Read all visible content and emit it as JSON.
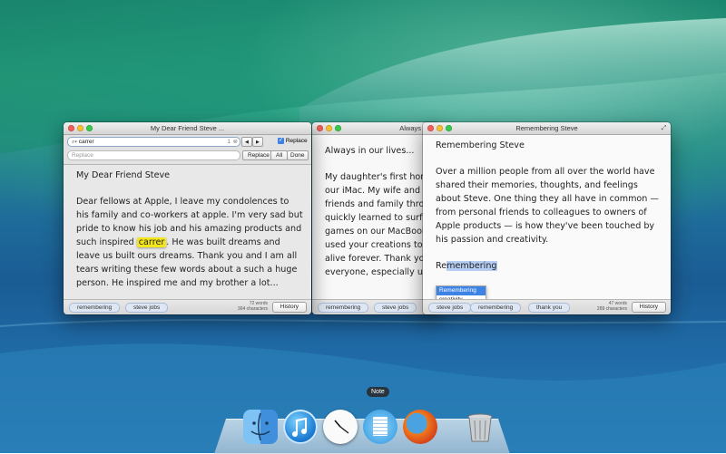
{
  "desktop": {
    "wallpaper": "ocean-wave"
  },
  "windows": {
    "win1": {
      "title": "My Dear Friend Steve ...",
      "find": {
        "query": "carrer",
        "count": "1",
        "replace_placeholder": "Replace",
        "replace_label": "Replace",
        "replace_checked": true,
        "replace_button": "Replace",
        "all_button": "All",
        "done_button": "Done",
        "prev_arrow": "◀",
        "next_arrow": "▶"
      },
      "doc_title": "My Dear Friend Steve",
      "body_before": "Dear fellows at Apple, I leave my condolences to his family and co-workers at apple. I'm very sad but pride to know his job and his amazing products and such inspired",
      "highlight": "carrer",
      "body_after": ". He was built dreams and leave us built ours dreams. Thank you and I am all tears writing these few words about a such a huge person. He inspired me and my brother a lot...",
      "tags": [
        "remembering",
        "steve jobs"
      ],
      "words": "72 words",
      "characters": "364 characters",
      "history_label": "History"
    },
    "win2": {
      "title": "Always",
      "doc_title": "Always in our lives...",
      "lines": [
        "My daughter's first home",
        "our iMac. My wife and",
        "friends and family throu",
        "quickly learned to surf t",
        "games on our MacBook",
        "used your creations to k",
        "alive forever. Thank you",
        "everyone, especially us."
      ],
      "tags": [
        "remembering",
        "steve jobs"
      ]
    },
    "win3": {
      "title": "Remembering Steve",
      "doc_title": "Remembering Steve",
      "body": "Over a million people from all over the world have shared their memories, thoughts, and feelings about Steve. One thing they all have in common — from personal friends to colleagues to owners of Apple products — is how they've been touched by his passion and creativity.",
      "typing_prefix": "Re",
      "typing_suggest": "membering",
      "autocomplete": [
        "Remembering",
        "creativity"
      ],
      "tags": [
        "steve jobs",
        "remembering",
        "thank you"
      ],
      "words": "47 words",
      "characters": "289 characters",
      "history_label": "History"
    }
  },
  "dock": {
    "tooltip": "Note",
    "icons": [
      "finder-icon",
      "itunes-icon",
      "clock-icon",
      "note-icon",
      "firefox-icon",
      "trash-icon"
    ]
  }
}
